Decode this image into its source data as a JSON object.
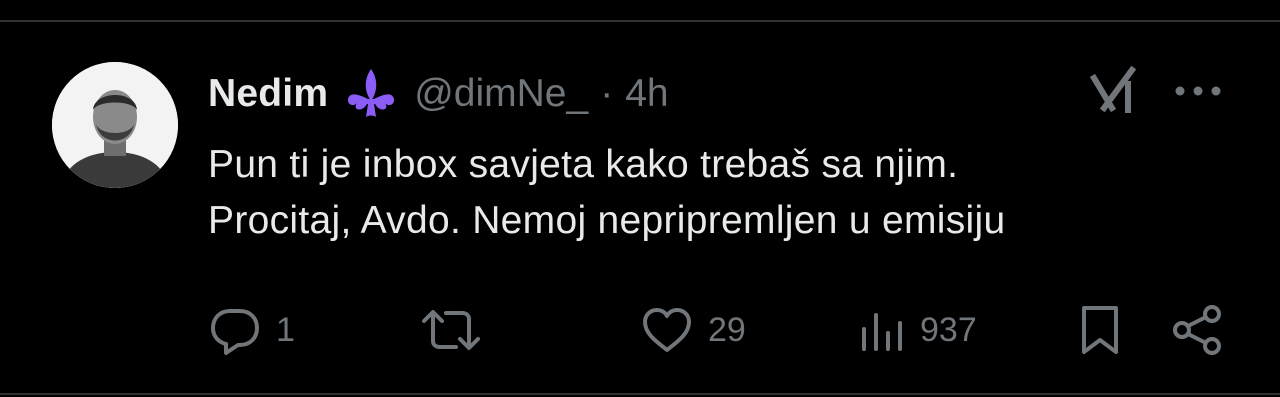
{
  "author": {
    "display_name": "Nedim",
    "handle": "@dimNe_",
    "separator": "·",
    "time": "4h",
    "badge_icon": "fleur-de-lis-icon",
    "badge_color": "#8b5cf6"
  },
  "tweet": {
    "lines": [
      "Pun ti je inbox savjeta kako trebaš sa njim.",
      "Procitaj, Avdo. Nemoj nepripremljen u emisiju"
    ]
  },
  "actions": {
    "reply_count": "1",
    "repost_count": "",
    "like_count": "29",
    "view_count": "937"
  },
  "icons": {
    "grok": "grok-icon",
    "more": "more-icon",
    "reply": "reply-icon",
    "repost": "repost-icon",
    "like": "heart-icon",
    "views": "views-icon",
    "bookmark": "bookmark-icon",
    "share": "share-icon"
  },
  "colors": {
    "background": "#000000",
    "primary_text": "#e7e9ea",
    "secondary_text": "#71767b",
    "divider": "#2f3336"
  }
}
